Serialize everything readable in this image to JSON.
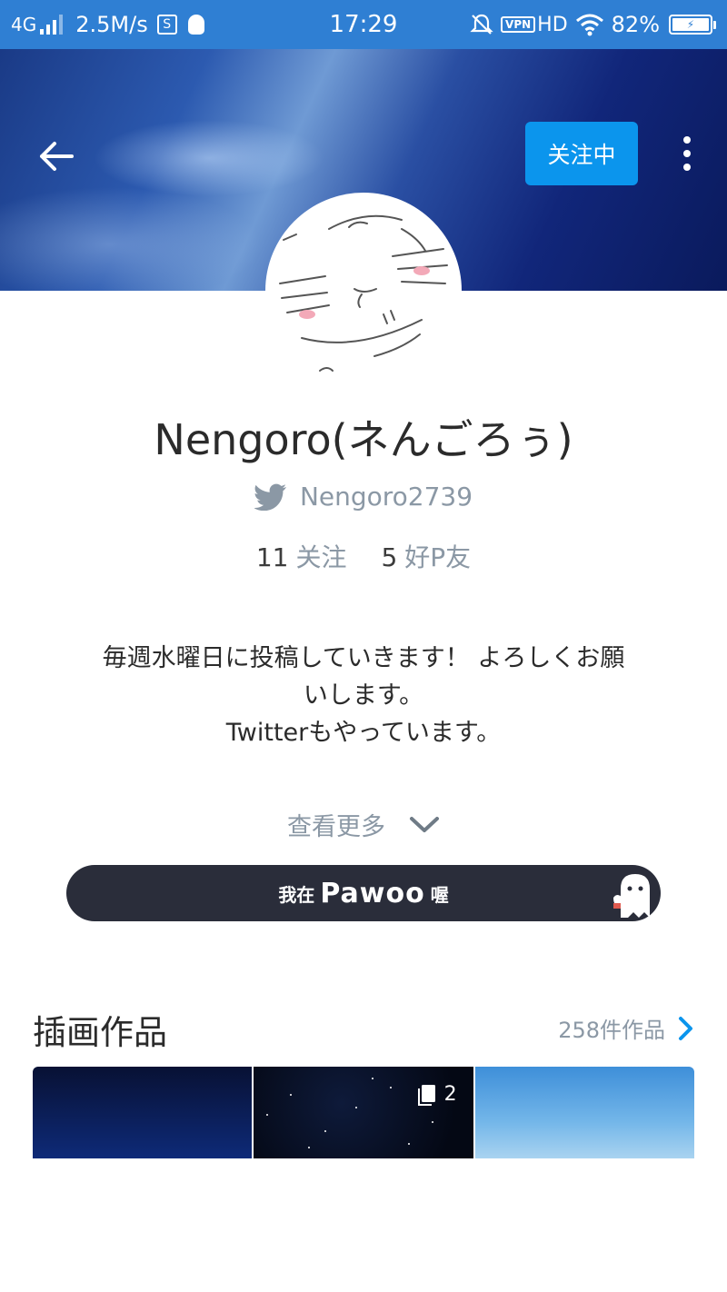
{
  "status_bar": {
    "network": "4G",
    "speed": "2.5M/s",
    "s_icon": "S",
    "time": "17:29",
    "vpn": "VPN",
    "hd": "HD",
    "battery": "82%"
  },
  "header": {
    "follow_label": "关注中"
  },
  "profile": {
    "name": "Nengoro(ネんごろぅ)",
    "twitter_handle": "Nengoro2739",
    "following_count": "11",
    "following_label": "关注",
    "friends_count": "5",
    "friends_label": "好P友",
    "bio_lines": [
      "毎週水曜日に投稿していきます！ よろしくお願",
      "いします。",
      "Twitterもやっています。"
    ],
    "see_more": "查看更多"
  },
  "pawoo_banner": {
    "prefix": "我在",
    "brand": "Pawoo",
    "suffix": "喔"
  },
  "illustrations": {
    "title": "插画作品",
    "count_label": "258件作品",
    "thumbs": [
      {
        "page_count": ""
      },
      {
        "page_count": "2"
      },
      {
        "page_count": ""
      }
    ]
  },
  "colors": {
    "status_bar": "#2f7fd3",
    "follow_button": "#0b95ed",
    "pawoo_banner": "#2a2d3a",
    "accent_chevron": "#0b95ed",
    "muted_text": "#8b98a5"
  }
}
